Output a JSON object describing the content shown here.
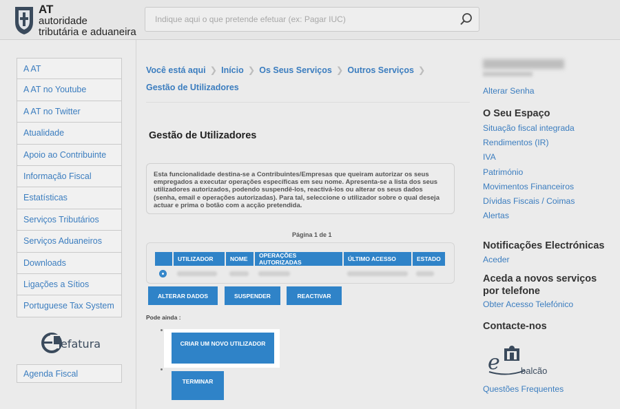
{
  "header": {
    "logo": {
      "line1": "AT",
      "line2": "autoridade",
      "line3": "tributária e aduaneira"
    },
    "search_placeholder": "Indique aqui o que pretende efetuar (ex: Pagar IUC)"
  },
  "left_menu": {
    "items": [
      "A AT",
      "A AT no Youtube",
      "A AT no Twitter",
      "Atualidade",
      "Apoio ao Contribuinte",
      "Informação Fiscal",
      "Estatísticas",
      "Serviços Tributários",
      "Serviços Aduaneiros",
      "Downloads",
      "Ligações a Sítios",
      "Portuguese Tax System"
    ],
    "efatura_label": "efatura",
    "agenda": "Agenda Fiscal"
  },
  "breadcrumb": {
    "items": [
      "Você está aqui",
      "Início",
      "Os Seus Serviços",
      "Outros Serviços",
      "Gestão de Utilizadores"
    ]
  },
  "main": {
    "title": "Gestão de Utilizadores",
    "info_text": "Esta funcionalidade destina-se a Contribuintes/Empresas que queiram autorizar os seus empregados a executar operações específicas em seu nome. Apresenta-se a lista dos seus utilizadores autorizados, podendo suspendê-los, reactivá-los ou alterar os seus dados (senha, email e operações autorizadas). Para tal, seleccione o utilizador sobre o qual deseja actuar e prima o botão com a acção pretendida.",
    "pager": "Página 1 de 1",
    "table": {
      "headers": [
        "UTILIZADOR",
        "NOME",
        "OPERAÇÕES AUTORIZADAS",
        "ÚLTIMO ACESSO",
        "ESTADO"
      ]
    },
    "buttons": {
      "alterar": "ALTERAR DADOS",
      "suspender": "SUSPENDER",
      "reactivar": "REACTIVAR"
    },
    "pode_ainda": "Pode ainda :",
    "criar": "CRIAR UM NOVO UTILIZADOR",
    "terminar": "TERMINAR"
  },
  "right": {
    "alterar_senha": "Alterar Senha",
    "espaco_title": "O Seu Espaço",
    "espaco_links": [
      "Situação fiscal integrada",
      "Rendimentos (IR)",
      "IVA",
      "Património",
      "Movimentos Financeiros",
      "Dívidas Fiscais / Coimas",
      "Alertas"
    ],
    "notif_title": "Notificações Electrónicas",
    "aceder": "Aceder",
    "telefone_title": "Aceda a novos serviços por telefone",
    "telefone_link": "Obter Acesso Telefónico",
    "contacte_title": "Contacte-nos",
    "ebalcao_label": "balcão",
    "questoes": "Questões Frequentes"
  },
  "colors": {
    "accent": "#2f83c8",
    "link": "#3b7dbf",
    "background": "#ebebeb"
  }
}
